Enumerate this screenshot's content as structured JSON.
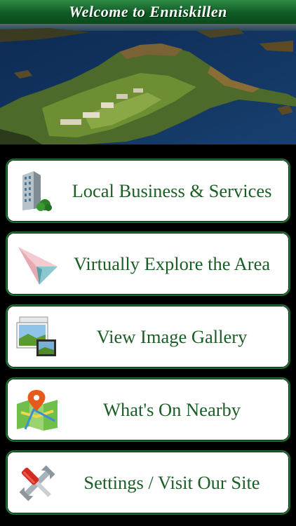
{
  "header": {
    "title": "Welcome to Enniskillen"
  },
  "hero": {
    "image": "aerial-lake-golf-resort"
  },
  "menu": {
    "items": [
      {
        "label": "Local Business & Services",
        "icon": "office-building-icon"
      },
      {
        "label": "Virtually Explore the Area",
        "icon": "paper-plane-icon"
      },
      {
        "label": "View Image Gallery",
        "icon": "photo-gallery-icon"
      },
      {
        "label": "What's On Nearby",
        "icon": "map-pin-icon"
      },
      {
        "label": "Settings / Visit Our Site",
        "icon": "tools-icon"
      }
    ]
  },
  "colors": {
    "header_green": "#0f5a24",
    "label_green": "#1b5e25",
    "border_green": "#1f6b2f",
    "background": "#000000"
  }
}
